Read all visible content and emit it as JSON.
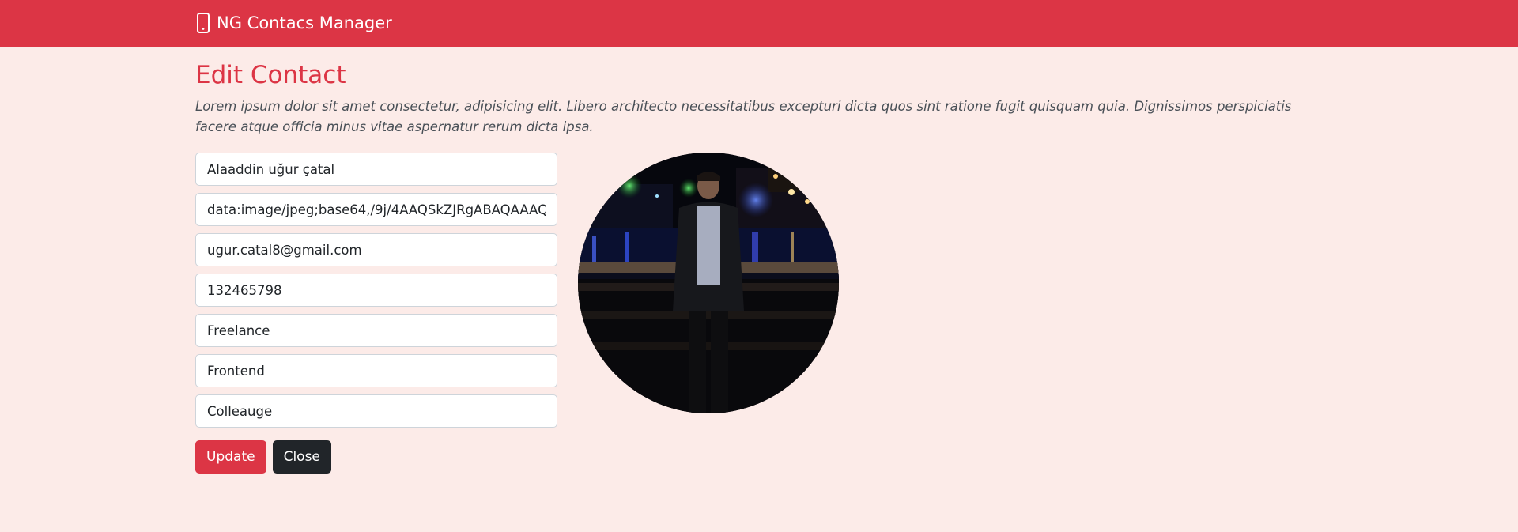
{
  "navbar": {
    "brand_icon": "mobile-phone-icon",
    "brand_label": "NG Contacs Manager"
  },
  "page": {
    "title": "Edit Contact",
    "description": "Lorem ipsum dolor sit amet consectetur, adipisicing elit. Libero architecto necessitatibus excepturi dicta quos sint ratione fugit quisquam quia. Dignissimos perspiciatis facere atque officia minus vitae aspernatur rerum dicta ipsa."
  },
  "form": {
    "name": "Alaaddin uğur çatal",
    "photo_url": "data:image/jpeg;base64,/9j/4AAQSkZJRgABAQAAAQA",
    "email": "ugur.catal8@gmail.com",
    "mobile": "132465798",
    "company": "Freelance",
    "title": "Frontend",
    "group": "Colleauge"
  },
  "buttons": {
    "update_label": "Update",
    "close_label": "Close"
  },
  "colors": {
    "navbar": "#dc3545",
    "background": "#fcebe8",
    "title": "#dc3545",
    "update_button": "#dc3545",
    "close_button": "#212529"
  },
  "photo": {
    "subject": "contact-photo-night-cityscape"
  }
}
